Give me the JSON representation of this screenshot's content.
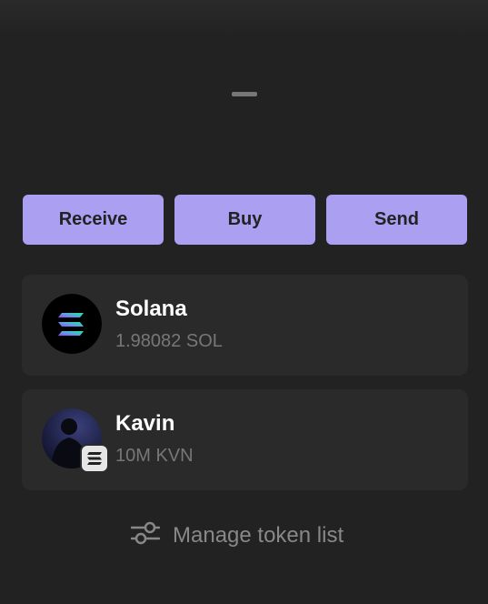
{
  "balance": {
    "placeholder": "–"
  },
  "actions": {
    "receive_label": "Receive",
    "buy_label": "Buy",
    "send_label": "Send"
  },
  "tokens": [
    {
      "name": "Solana",
      "amount": "1.98082 SOL",
      "icon": "solana-logo-icon"
    },
    {
      "name": "Kavin",
      "amount": "10M KVN",
      "icon": "kavin-avatar",
      "badge": "solana-chain-badge-icon"
    }
  ],
  "footer": {
    "manage_label": "Manage token list",
    "icon": "sliders-icon"
  },
  "colors": {
    "background": "#222222",
    "card": "#2a2a2a",
    "accent": "#ab9ff2",
    "muted_text": "#777777"
  }
}
